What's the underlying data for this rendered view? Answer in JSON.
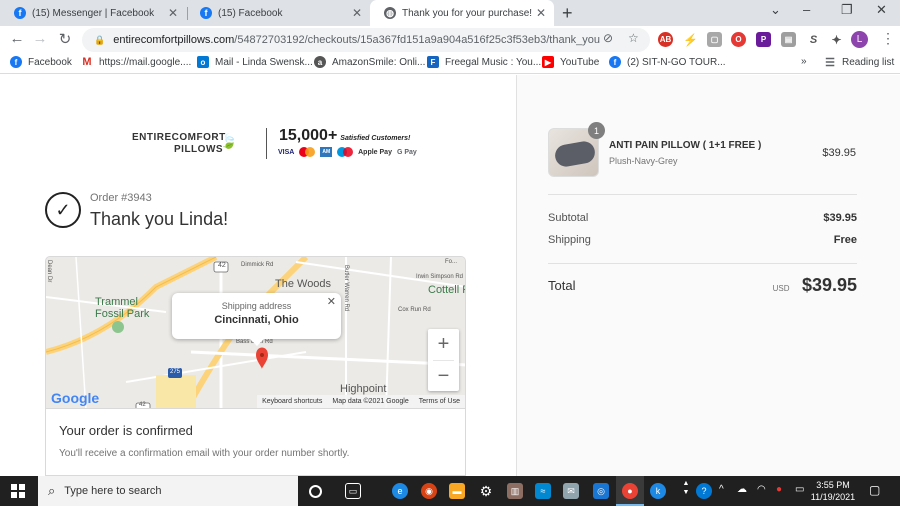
{
  "browser": {
    "tabs": [
      {
        "title": "(15) Messenger | Facebook",
        "icon": "facebook-icon",
        "active": false
      },
      {
        "title": "(15) Facebook",
        "icon": "facebook-icon",
        "active": false
      },
      {
        "title": "Thank you for your purchase! - E",
        "icon": "globe-icon",
        "active": true
      }
    ],
    "url_host": "entirecomfortpillows.com",
    "url_path": "/54872703192/checkouts/15a367fd151a9a904a516f25c3f53eb3/thank_you",
    "profile_initial": "L",
    "bookmarks": [
      {
        "label": "Facebook",
        "icon": "facebook-icon"
      },
      {
        "label": "https://mail.google....",
        "icon": "gmail-icon"
      },
      {
        "label": "Mail - Linda Swensk...",
        "icon": "outlook-icon"
      },
      {
        "label": "AmazonSmile: Onli...",
        "icon": "amazon-icon"
      },
      {
        "label": "Freegal Music : You...",
        "icon": "freegal-icon"
      },
      {
        "label": "YouTube",
        "icon": "youtube-icon"
      },
      {
        "label": "(2) SIT-N-GO TOUR...",
        "icon": "facebook-icon"
      }
    ],
    "reading_list": "Reading list",
    "overflow": "»"
  },
  "header": {
    "brand_line1": "ENTIRECOMFORT",
    "brand_line2": "PILLOWS",
    "customers_count": "15,000+",
    "customers_label": "Satisfied Customers!",
    "payment_methods": [
      "VISA",
      "Mastercard",
      "Amex",
      "Maestro",
      "Apple Pay",
      "G Pay"
    ]
  },
  "order": {
    "number": "Order #3943",
    "thank_you": "Thank you Linda!"
  },
  "map": {
    "popup_label": "Shipping address",
    "popup_city": "Cincinnati, Ohio",
    "places": [
      "The Woods",
      "Trammel Fossil Park",
      "Cottell F",
      "Highpoint"
    ],
    "roads": [
      "Dimmick Rd",
      "Dean Dr",
      "Butler Warren Rd",
      "Irwin Simpson Rd",
      "Cox Run Rd",
      "Bass Ertel Rd",
      "Fo...",
      "42",
      "275",
      "42"
    ],
    "attribution": [
      "Keyboard shortcuts",
      "Map data ©2021 Google",
      "Terms of Use"
    ],
    "google_logo": "Google"
  },
  "confirmation": {
    "heading": "Your order is confirmed",
    "body": "You'll receive a confirmation email with your order number shortly."
  },
  "summary": {
    "product_name": "ANTI PAIN PILLOW ( 1+1 FREE )",
    "product_variant": "Plush-Navy-Grey",
    "product_price": "$39.95",
    "quantity": "1",
    "subtotal_label": "Subtotal",
    "subtotal_value": "$39.95",
    "shipping_label": "Shipping",
    "shipping_value": "Free",
    "total_label": "Total",
    "currency": "USD",
    "total_value": "$39.95"
  },
  "taskbar": {
    "search_placeholder": "Type here to search",
    "time": "3:55 PM",
    "date": "11/19/2021"
  }
}
